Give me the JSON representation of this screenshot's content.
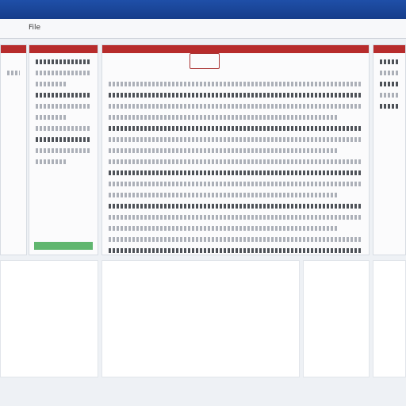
{
  "window": {
    "title": "",
    "menu": [
      "File"
    ]
  },
  "panels": {
    "left": {
      "title": ""
    },
    "center": {
      "title": ""
    },
    "right": {
      "title": ""
    }
  },
  "bottom": {
    "blocks": [
      {
        "label": ""
      },
      {
        "label": ""
      },
      {
        "label": ""
      },
      {
        "label": ""
      }
    ]
  }
}
